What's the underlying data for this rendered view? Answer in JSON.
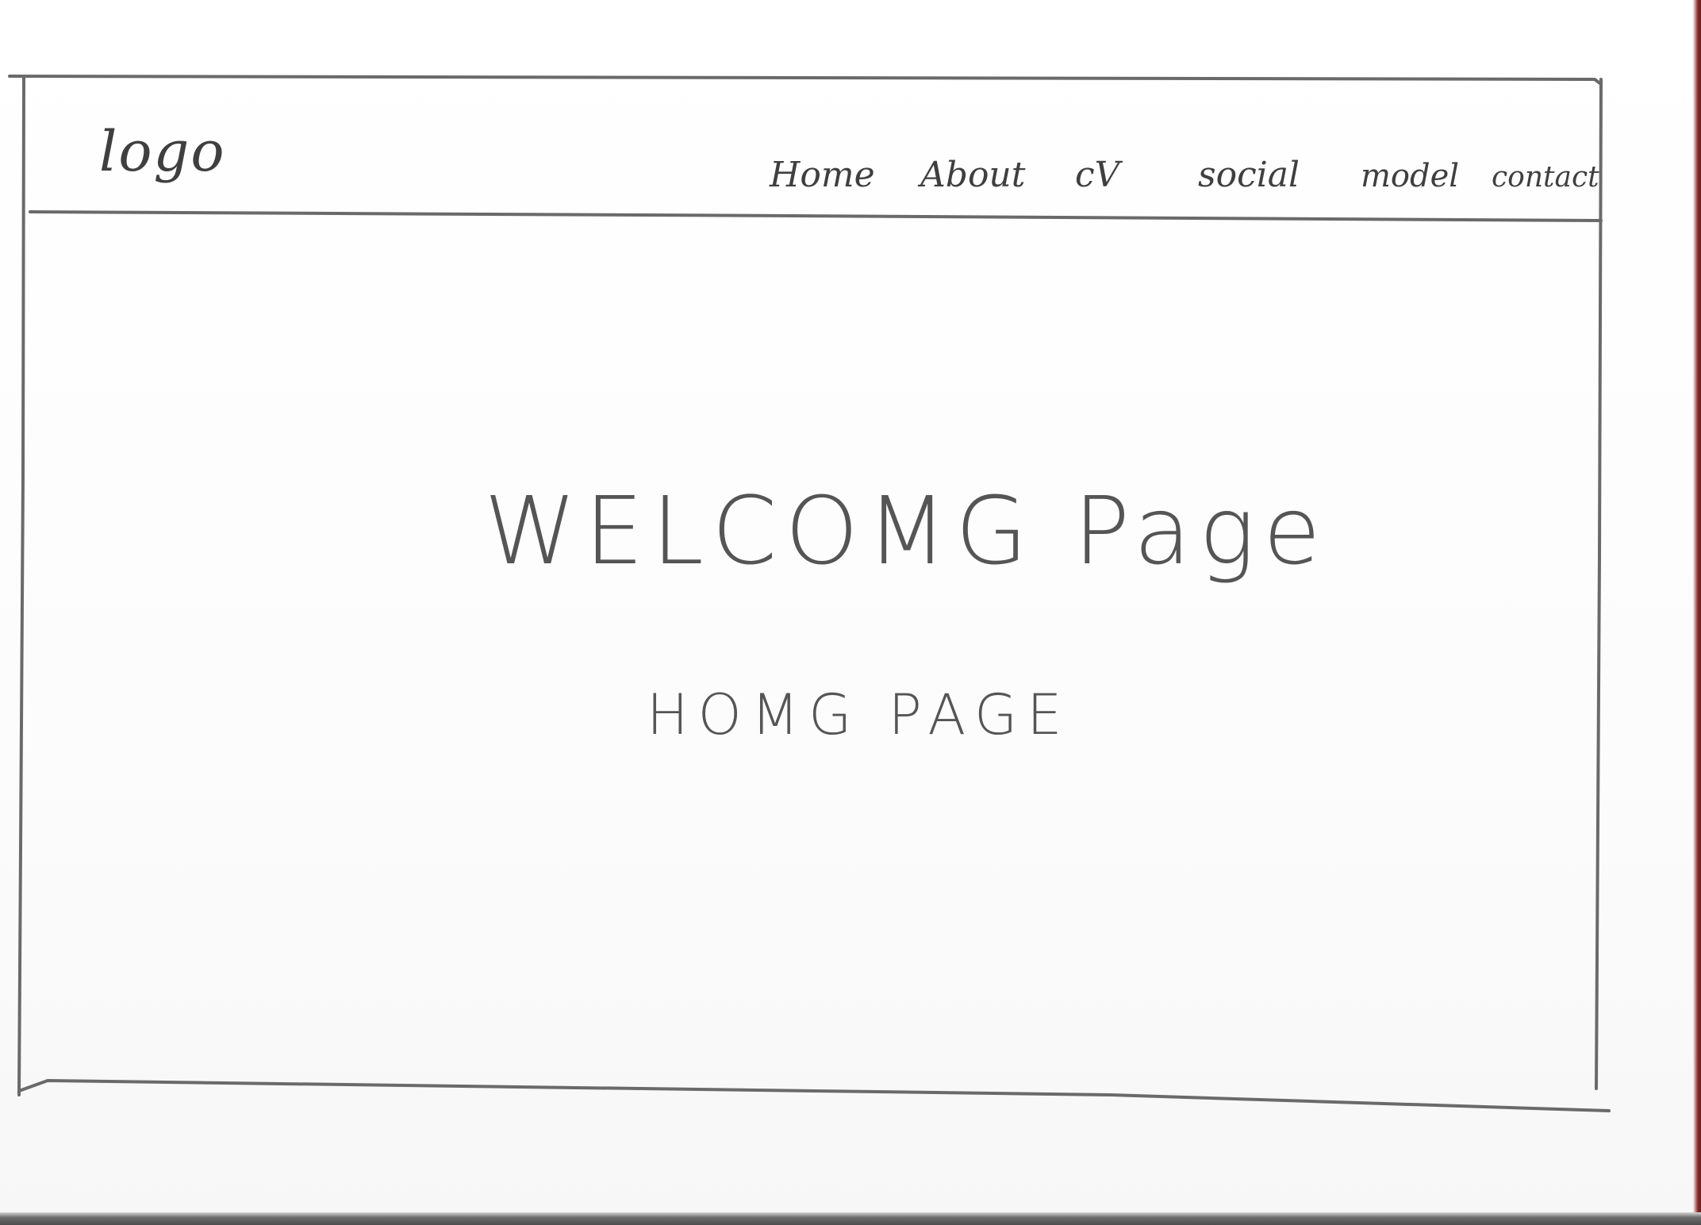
{
  "header": {
    "logo_text": "logo",
    "nav": {
      "home": "Home",
      "about": "About",
      "cv": "cV",
      "social": "social",
      "model": "model",
      "contact": "contact"
    }
  },
  "main": {
    "title": "WELCOMG Page",
    "subtitle": "HOMG PAGE"
  }
}
